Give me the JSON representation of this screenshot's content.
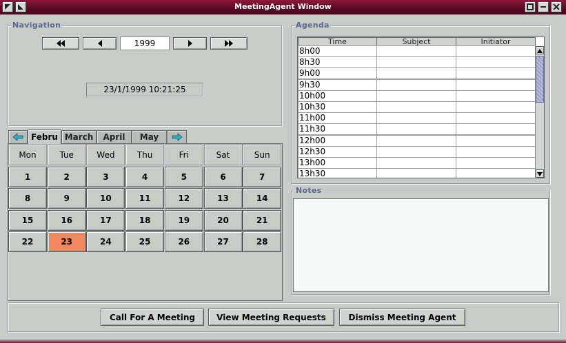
{
  "window": {
    "title": "MeetingAgent Window"
  },
  "navigation": {
    "title": "Navigation",
    "year": "1999",
    "datetime": "23/1/1999  10:21:25"
  },
  "tabs": {
    "labels": [
      "Febru",
      "March",
      "April",
      "May"
    ],
    "selected": "Febru"
  },
  "calendar": {
    "weekdays": [
      "Mon",
      "Tue",
      "Wed",
      "Thu",
      "Fri",
      "Sat",
      "Sun"
    ],
    "weeks": [
      [
        "1",
        "2",
        "3",
        "4",
        "5",
        "6",
        "7"
      ],
      [
        "8",
        "9",
        "10",
        "11",
        "12",
        "13",
        "14"
      ],
      [
        "15",
        "16",
        "17",
        "18",
        "19",
        "20",
        "21"
      ],
      [
        "22",
        "23",
        "24",
        "25",
        "26",
        "27",
        "28"
      ]
    ],
    "today": "23",
    "today_color": "#f4875e"
  },
  "agenda": {
    "title": "Agenda",
    "columns": [
      "Time",
      "Subject",
      "Initiator"
    ],
    "rows": [
      {
        "time": "8h00",
        "subject": "",
        "initiator": ""
      },
      {
        "time": "8h30",
        "subject": "",
        "initiator": ""
      },
      {
        "time": "9h00",
        "subject": "",
        "initiator": ""
      },
      {
        "time": "9h30",
        "subject": "",
        "initiator": ""
      },
      {
        "time": "10h00",
        "subject": "",
        "initiator": ""
      },
      {
        "time": "10h30",
        "subject": "",
        "initiator": ""
      },
      {
        "time": "11h00",
        "subject": "",
        "initiator": ""
      },
      {
        "time": "11h30",
        "subject": "",
        "initiator": ""
      },
      {
        "time": "12h00",
        "subject": "",
        "initiator": ""
      },
      {
        "time": "12h30",
        "subject": "",
        "initiator": ""
      },
      {
        "time": "13h00",
        "subject": "",
        "initiator": ""
      },
      {
        "time": "13h30",
        "subject": "",
        "initiator": ""
      }
    ]
  },
  "notes": {
    "title": "Notes",
    "value": ""
  },
  "actions": {
    "call_meeting": "Call For A Meeting",
    "view_requests": "View Meeting Requests",
    "dismiss": "Dismiss Meeting Agent"
  },
  "colors": {
    "titlebar": "#5e0b27",
    "group_title": "#5a6790",
    "tab_arrow": "#2ab0c8"
  },
  "icons": {
    "window_menu": "window-menu-icon",
    "window_shade": "window-shade-icon",
    "minimize": "minimize-icon",
    "maximize": "maximize-icon",
    "close": "close-icon",
    "fast_back": "fast-back-icon",
    "back": "back-icon",
    "forward": "forward-icon",
    "fast_forward": "fast-forward-icon",
    "tab_left": "tab-left-arrow-icon",
    "tab_right": "tab-right-arrow-icon"
  }
}
